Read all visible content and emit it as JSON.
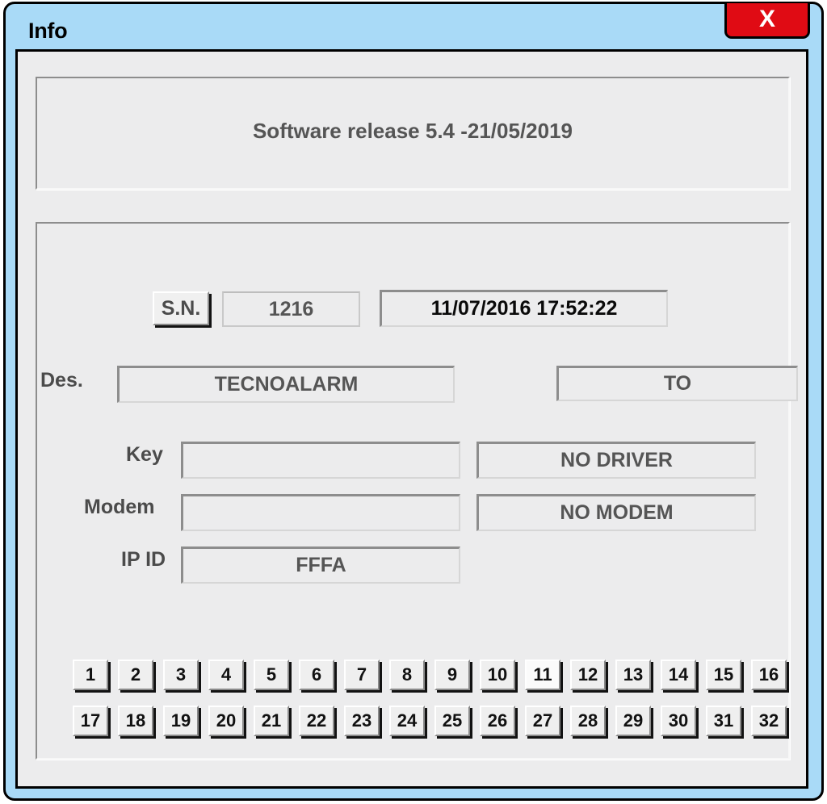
{
  "window": {
    "title": "Info",
    "close_label": "X",
    "close_icon": "close-icon",
    "titlebar_color": "#a9daf7",
    "close_color": "#e00b14",
    "client_color": "#ececed"
  },
  "release": {
    "text": "Software release 5.4 -21/05/2019"
  },
  "info": {
    "sn_button_label": "S.N.",
    "sn_value": "1216",
    "datetime_value": "11/07/2016 17:52:22",
    "des_label": "Des.",
    "des_value": "TECNOALARM",
    "city_value": "TO",
    "key_label": "Key",
    "key_value": "",
    "driver_status": "NO DRIVER",
    "modem_label": "Modem",
    "modem_value": "",
    "modem_status": "NO MODEM",
    "ipid_label": "IP ID",
    "ipid_value": "FFFA"
  },
  "buttons": {
    "row1": [
      "1",
      "2",
      "3",
      "4",
      "5",
      "6",
      "7",
      "8",
      "9",
      "10",
      "11",
      "12",
      "13",
      "14",
      "15",
      "16"
    ],
    "row2": [
      "17",
      "18",
      "19",
      "20",
      "21",
      "22",
      "23",
      "24",
      "25",
      "26",
      "27",
      "28",
      "29",
      "30",
      "31",
      "32"
    ],
    "focused_index_row1": 10
  }
}
